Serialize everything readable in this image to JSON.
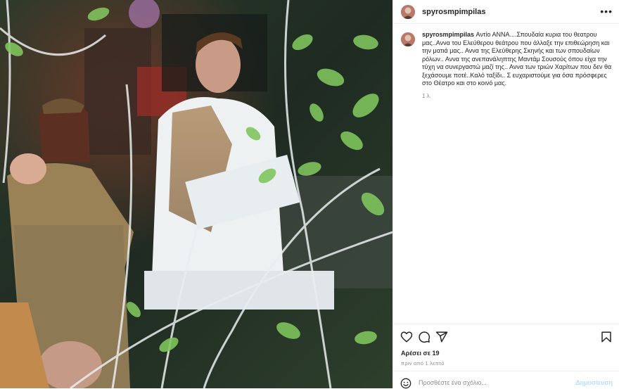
{
  "post": {
    "username": "spyrosmpimpilas",
    "more_icon": "more-horizontal-icon",
    "caption_username": "spyrosmpimpilas",
    "caption": "Αντίο ΑΝΝΑ....Σπουδαία κυρια του θεατρου μας..Αννα του Ελεύθερου θεάτρου που άλλαξε την επιθεώρηση και την ματιά μας.. Αννα της Ελεύθερης Σκηνής και των σπουδαίων ρόλων.. Αννα της ανεπανάληπτης Μαντάμ Σουσούς όπου είχα την τύχη να συνεργαστώ μαζί της.. Αννα των τριών Χαρίτων που δεν θα ξεχάσουμε ποτέ..Καλό ταξίδι.. Σ ευχαριστούμε για όσα πρόσφερες στο Θέατρο και στο κοινό μας.",
    "caption_age": "1 λ.",
    "likes": "Αρέσει σε 19",
    "time_ago": "πριν από 1 λεπτό",
    "comment_placeholder": "Προσθέστε ένα σχόλιο...",
    "post_button": "Δημοσίευση"
  },
  "icons": {
    "like": "heart-icon",
    "comment": "comment-icon",
    "share": "send-icon",
    "save": "bookmark-icon",
    "emoji": "emoji-icon"
  },
  "colors": {
    "text": "#262626",
    "secondary": "#8e8e8e",
    "divider": "#efefef",
    "post_button_disabled": "#b2dffc"
  }
}
